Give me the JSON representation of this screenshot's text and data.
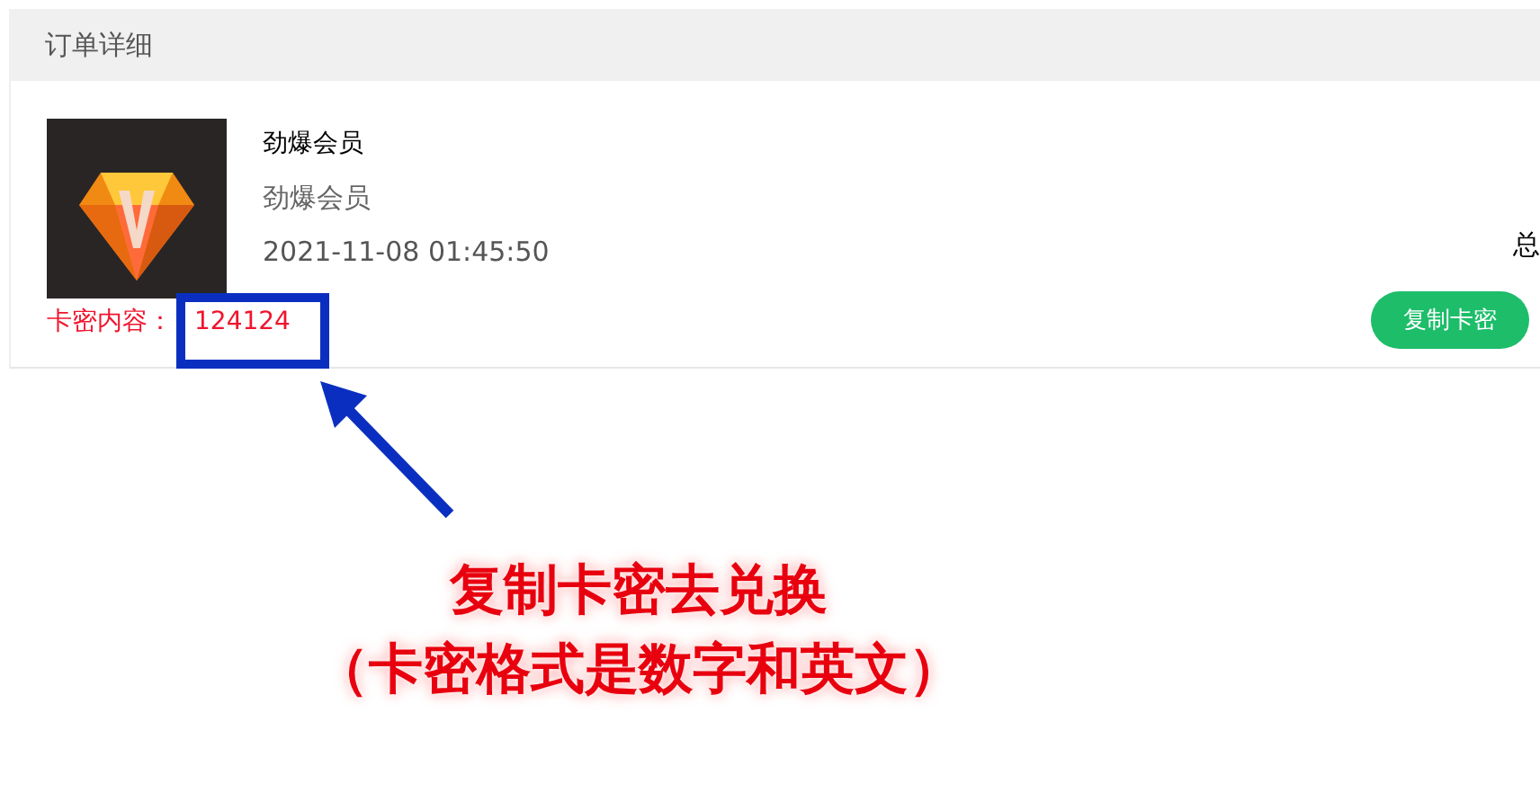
{
  "section": {
    "title": "订单详细"
  },
  "order": {
    "name": "劲爆会员",
    "subtitle": "劲爆会员",
    "time": "2021-11-08 01:45:50",
    "total_label": "总",
    "card_label": "卡密内容：",
    "card_value": "124124",
    "copy_button": "复制卡密"
  },
  "annotation": {
    "lines": [
      "复制卡密去兑换",
      "（卡密格式是数字和英文）"
    ]
  }
}
